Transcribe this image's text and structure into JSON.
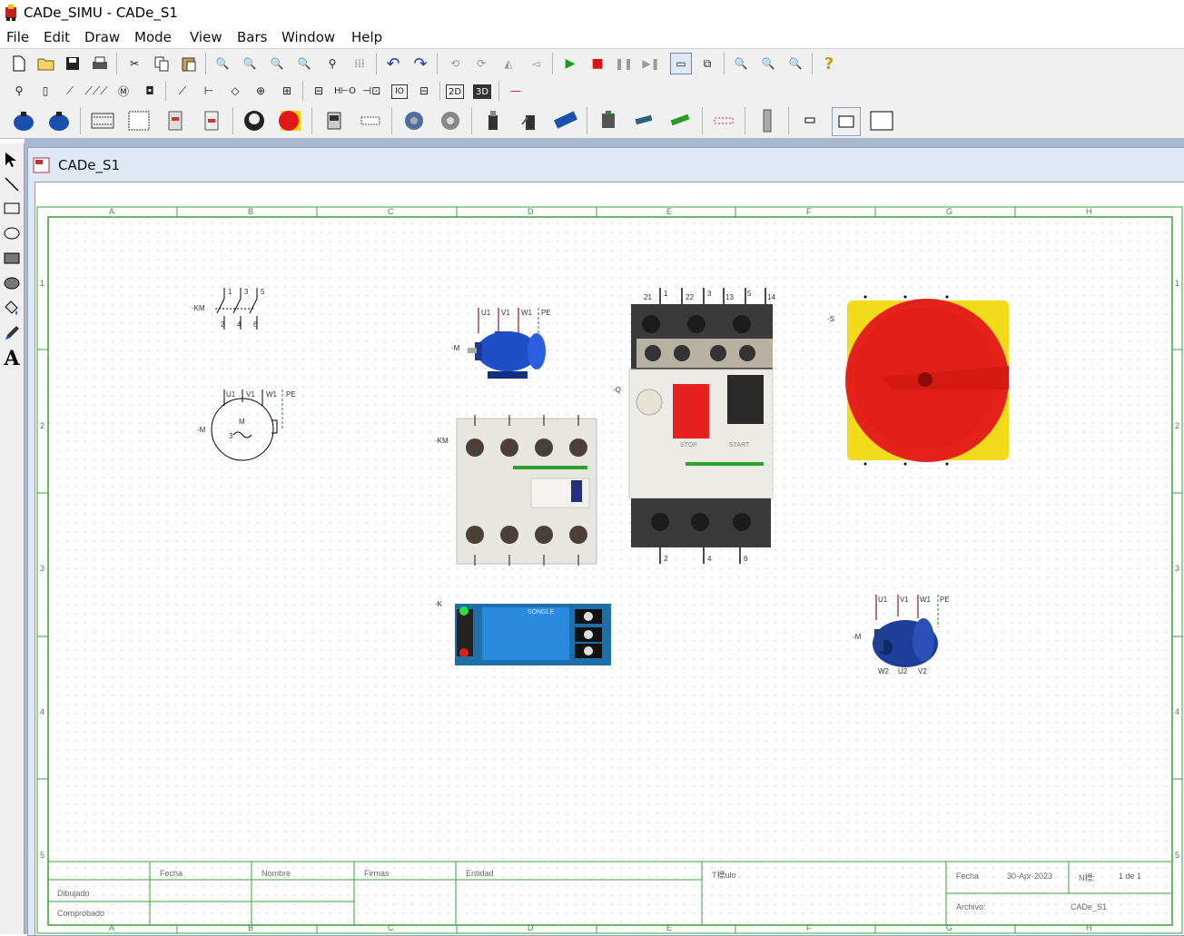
{
  "window": {
    "title": "CADe_SIMU - CADe_S1"
  },
  "menu": [
    "File",
    "Edit",
    "Draw",
    "Mode",
    "View",
    "Bars",
    "Window",
    "Help"
  ],
  "document": {
    "title": "CADe_S1"
  },
  "toolbar2": {
    "btn_2d": "2D",
    "btn_3d": "3D"
  },
  "frame": {
    "cols": [
      "A",
      "B",
      "C",
      "D",
      "E",
      "F",
      "G",
      "H"
    ],
    "rows": [
      "1",
      "2",
      "3",
      "4",
      "5"
    ]
  },
  "title_block": {
    "fecha_h": "Fecha",
    "nombre_h": "Nombre",
    "firmas_h": "Firmas",
    "entidad_h": "Entidad",
    "titulo_h": "T標ulo",
    "dibujado": "Dibujado",
    "comprobado": "Comprobado",
    "fecha_label": "Fecha",
    "fecha_value": "30-Apr-2023",
    "n_label": "N標:",
    "n_value": "1 de 1",
    "archivo_label": "Archivo:",
    "archivo_value": "CADe_S1"
  },
  "components": {
    "contact_km": {
      "tag": "-KM",
      "pins": [
        "1",
        "3",
        "5",
        "2",
        "4",
        "6"
      ]
    },
    "motor_symbol": {
      "tag": "-M",
      "pins": [
        "U1",
        "V1",
        "W1",
        "PE"
      ],
      "label": "M",
      "phases": "3",
      "wave": "~"
    },
    "motor_3d_1": {
      "tag": "-M",
      "pins": [
        "U1",
        "V1",
        "W1",
        "PE"
      ]
    },
    "contactor_3d": {
      "tag": "-KM"
    },
    "breaker_q": {
      "tag": "-Q",
      "top_pins": [
        "21",
        "1",
        "22",
        "3",
        "13",
        "5",
        "14"
      ],
      "bottom_pins": [
        "2",
        "4",
        "6"
      ],
      "stop": "STOP",
      "start": "START"
    },
    "switch_s": {
      "tag": "-S"
    },
    "relay_k": {
      "tag": "-K",
      "brand": "SONGLE"
    },
    "motor_3d_2": {
      "tag": "-M",
      "pins": [
        "U1",
        "V1",
        "W1",
        "PE"
      ],
      "bottom_pins": [
        "W2",
        "U2",
        "V2"
      ]
    }
  },
  "colors": {
    "accent_green": "#2e9e2e",
    "frame_green": "#3aa03a",
    "mdi_blue": "#a9b8cf",
    "red": "#e02020",
    "yellow": "#f0e020"
  }
}
